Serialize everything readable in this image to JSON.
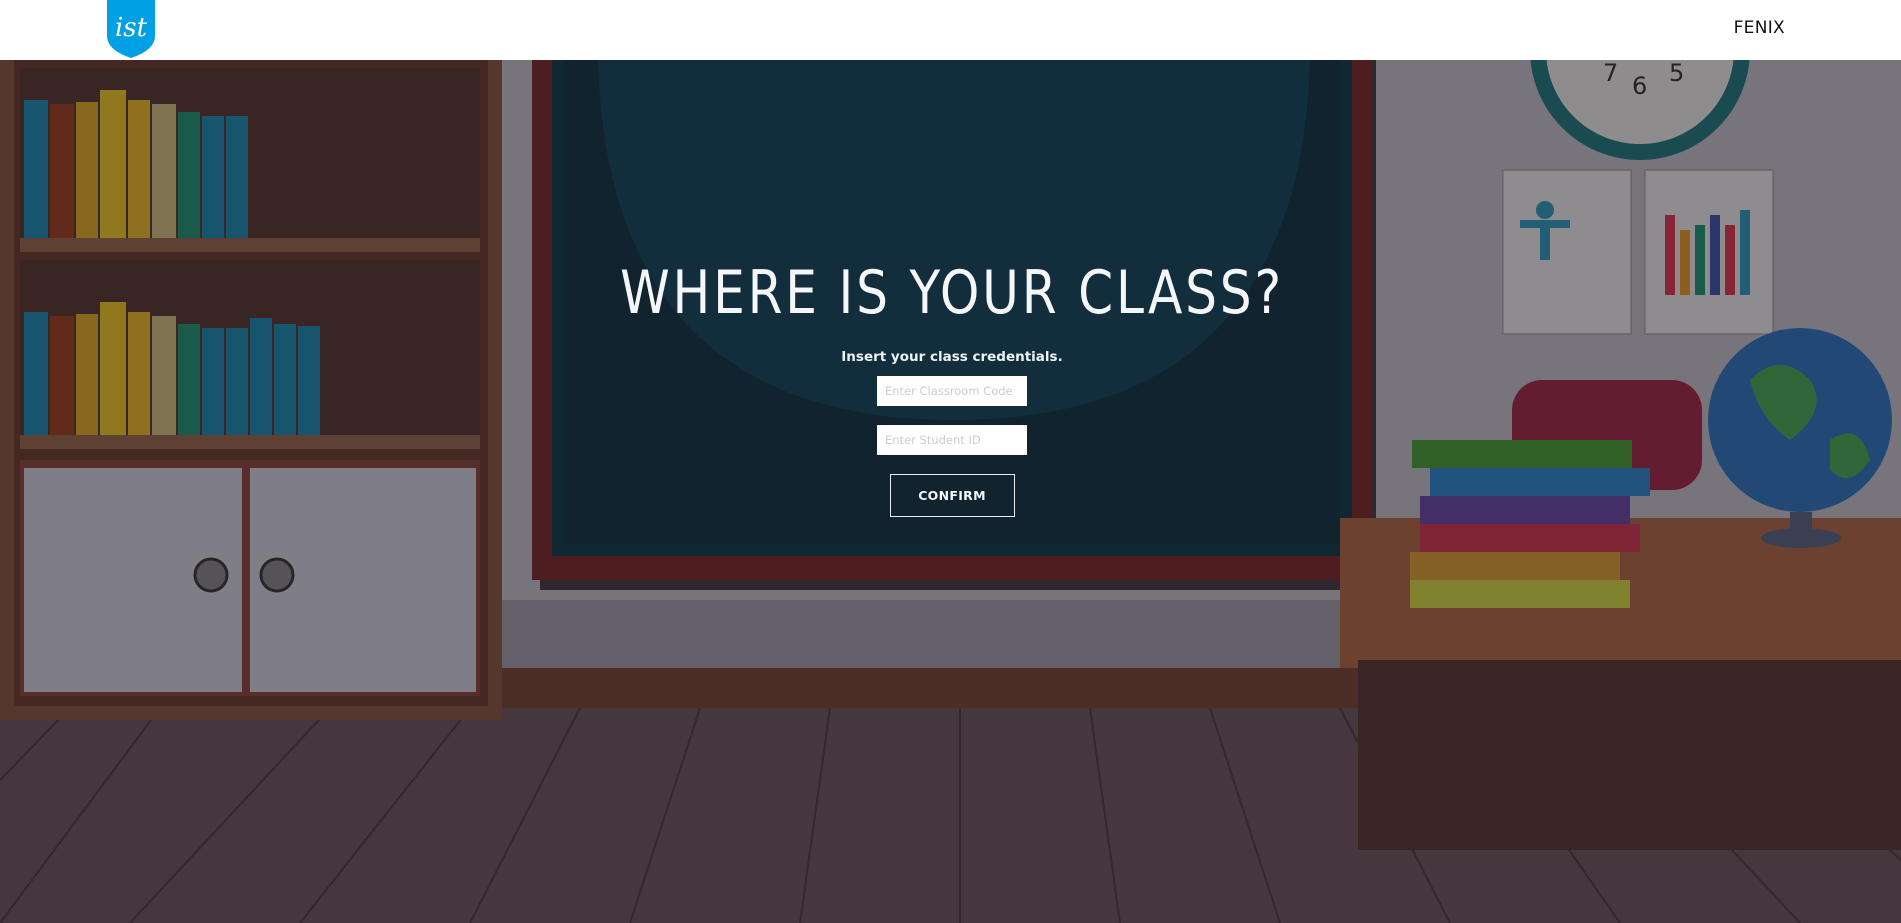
{
  "header": {
    "logo_text": "ist",
    "nav_link": "FENIX"
  },
  "main": {
    "title": "WHERE IS YOUR CLASS?",
    "subtitle": "Insert your class credentials.",
    "classroom_code_placeholder": "Enter Classroom Code",
    "student_id_placeholder": "Enter Student ID",
    "confirm_label": "CONFIRM"
  },
  "scene": {
    "clock_numbers": [
      "7",
      "6",
      "5"
    ]
  },
  "colors": {
    "brand_blue": "#00A0E4",
    "chalkboard": "#0e3a4c",
    "overlay_dim": "rgba(20,14,18,0.45)"
  }
}
